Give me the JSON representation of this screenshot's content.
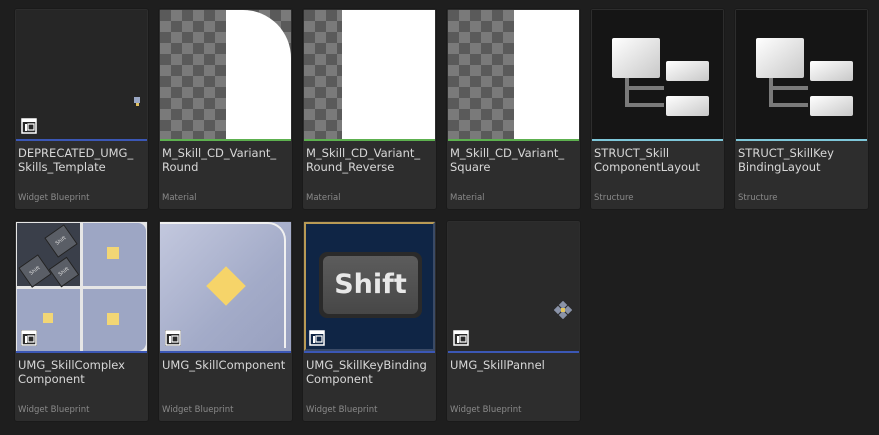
{
  "colors": {
    "widget_bar": "#3b57b5",
    "material_bar": "#5db04f",
    "structure_bar": "#7ec7d9"
  },
  "assets": [
    {
      "name": "DEPRECATED_UMG_\nSkills_Template",
      "type": "Widget Blueprint",
      "icon": "widget-blueprint-icon"
    },
    {
      "name": "M_Skill_CD_Variant_\nRound",
      "type": "Material",
      "icon": "material-thumbnail"
    },
    {
      "name": "M_Skill_CD_Variant_\nRound_Reverse",
      "type": "Material",
      "icon": "material-thumbnail"
    },
    {
      "name": "M_Skill_CD_Variant_\nSquare",
      "type": "Material",
      "icon": "material-thumbnail"
    },
    {
      "name": "STRUCT_Skill\nComponentLayout",
      "type": "Structure",
      "icon": "structure-icon"
    },
    {
      "name": "STRUCT_SkillKey\nBindingLayout",
      "type": "Structure",
      "icon": "structure-icon"
    },
    {
      "name": "UMG_SkillComplex\nComponent",
      "type": "Widget Blueprint",
      "icon": "widget-blueprint-icon"
    },
    {
      "name": "UMG_SkillComponent",
      "type": "Widget Blueprint",
      "icon": "widget-blueprint-icon"
    },
    {
      "name": "UMG_SkillKeyBinding\nComponent",
      "type": "Widget Blueprint",
      "icon": "widget-blueprint-icon",
      "thumb_text": "Shift"
    },
    {
      "name": "UMG_SkillPannel",
      "type": "Widget Blueprint",
      "icon": "widget-blueprint-icon"
    }
  ],
  "mini_key_label": "Shift"
}
